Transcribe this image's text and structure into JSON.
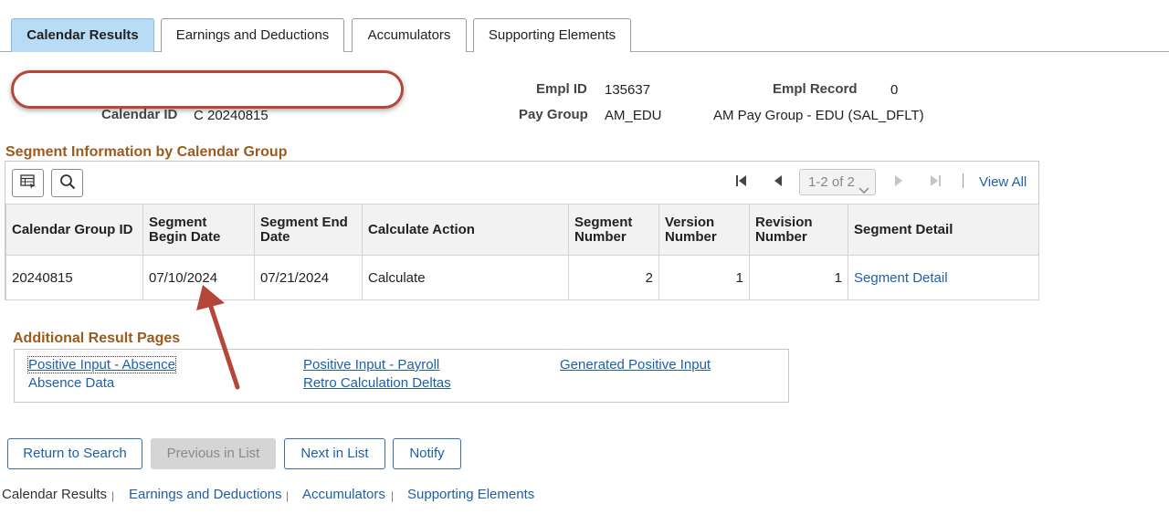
{
  "tabs": [
    {
      "label": "Calendar Results",
      "active": true
    },
    {
      "label": "Earnings and Deductions",
      "active": false
    },
    {
      "label": "Accumulators",
      "active": false
    },
    {
      "label": "Supporting Elements",
      "active": false
    }
  ],
  "header": {
    "calendar_id_label": "Calendar ID",
    "calendar_id_value": "C 20240815",
    "empl_id_label": "Empl ID",
    "empl_id_value": "135637",
    "empl_record_label": "Empl Record",
    "empl_record_value": "0",
    "pay_group_label": "Pay Group",
    "pay_group_value": "AM_EDU",
    "pay_group_desc": "AM Pay Group - EDU (SAL_DFLT)"
  },
  "segment_section": {
    "title": "Segment Information by Calendar Group",
    "pager_text": "1-2 of 2",
    "view_all": "View All",
    "columns": [
      "Calendar Group ID",
      "Segment Begin Date",
      "Segment End Date",
      "Calculate Action",
      "Segment Number",
      "Version Number",
      "Revision Number",
      "Segment Detail"
    ],
    "rows": [
      {
        "calendar_group_id": "20240815",
        "begin_date": "07/10/2024",
        "end_date": "07/21/2024",
        "calculate_action": "Calculate",
        "segment_number": "2",
        "version_number": "1",
        "revision_number": "1",
        "segment_detail": "Segment Detail"
      }
    ]
  },
  "additional": {
    "title": "Additional Result Pages",
    "links": [
      "Positive Input - Absence",
      "Absence Data",
      "Positive Input - Payroll",
      "Retro Calculation Deltas",
      "Generated Positive Input"
    ]
  },
  "buttons": {
    "return_to_search": "Return to Search",
    "previous_in_list": "Previous in List",
    "next_in_list": "Next in List",
    "notify": "Notify"
  },
  "footer": {
    "links": [
      "Calendar Results",
      "Earnings and Deductions",
      "Accumulators",
      "Supporting Elements"
    ],
    "separator": "|"
  },
  "colors": {
    "accent_link": "#1f5fa6",
    "section_title": "#9c5a1c",
    "active_tab": "#b9dcf6",
    "annotation": "#b5473a"
  },
  "icons": [
    "grid-personalize-icon",
    "search-icon",
    "first-page-icon",
    "previous-page-icon",
    "next-page-icon",
    "last-page-icon",
    "chevron-down-icon",
    "annotation-arrow-icon"
  ]
}
